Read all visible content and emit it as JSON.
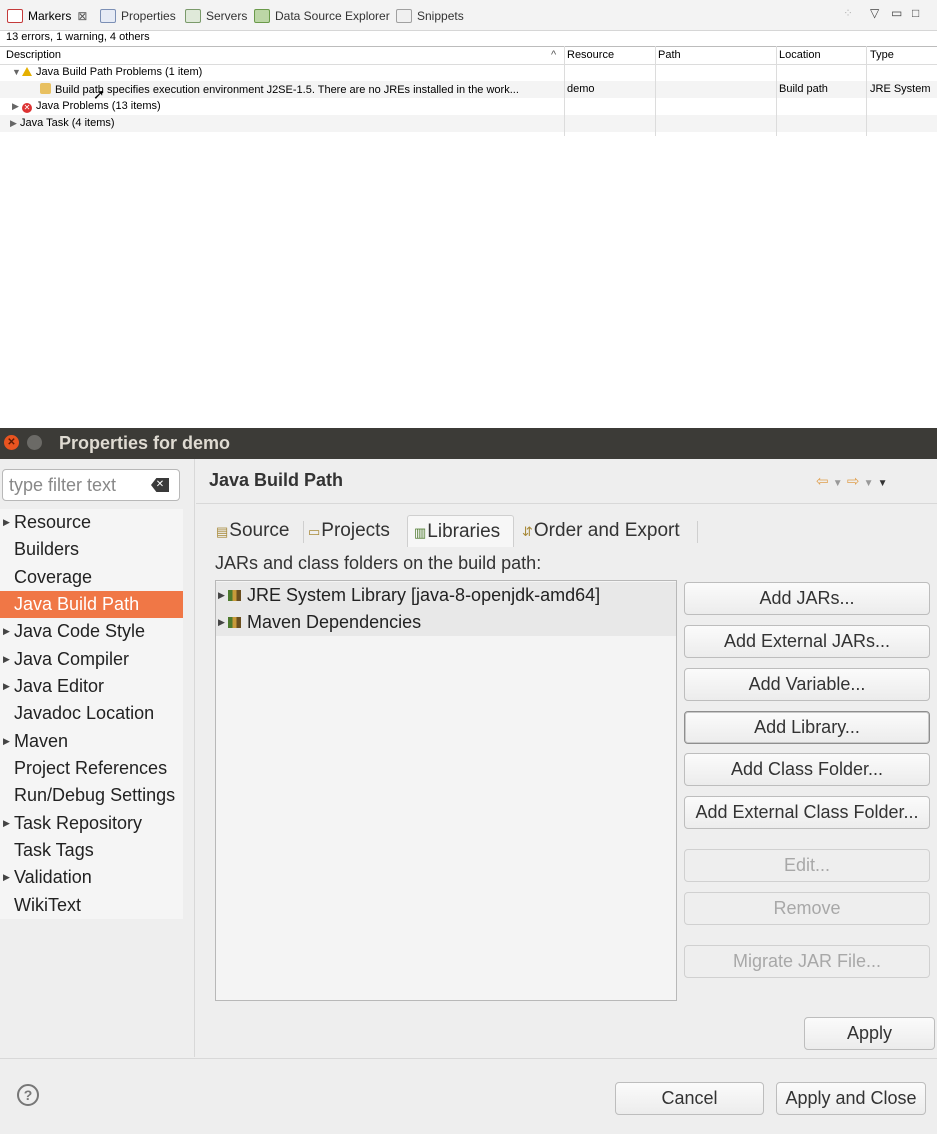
{
  "markers_view": {
    "tabs": [
      {
        "label": "Markers",
        "icon": "markers-icon",
        "color": "#c43a3a"
      },
      {
        "label": "Properties",
        "icon": "properties-icon",
        "color": "#7b8fb5"
      },
      {
        "label": "Servers",
        "icon": "servers-icon",
        "color": "#7a9a6a"
      },
      {
        "label": "Data Source Explorer",
        "icon": "data-source-icon",
        "color": "#6a9a4a"
      },
      {
        "label": "Snippets",
        "icon": "snippets-icon",
        "color": "#a0a0a0"
      }
    ],
    "summary": "13 errors, 1 warning, 4 others",
    "columns": [
      "Description",
      "Resource",
      "Path",
      "Location",
      "Type"
    ],
    "rows": [
      {
        "description": "Java Build Path Problems (1 item)",
        "resource": "",
        "path": "",
        "location": "",
        "type": "",
        "icon": "warning-icon",
        "expanded": true
      },
      {
        "description": "Build path specifies execution environment J2SE-1.5. There are no JREs installed in the work...",
        "resource": "demo",
        "path": "",
        "location": "Build path",
        "type": "JRE System",
        "icon": "warning-marker-icon"
      },
      {
        "description": "Java Problems (13 items)",
        "resource": "",
        "path": "",
        "location": "",
        "type": "",
        "icon": "error-icon",
        "expanded": false
      },
      {
        "description": "Java Task (4 items)",
        "resource": "",
        "path": "",
        "location": "",
        "type": "",
        "icon": "",
        "expanded": false
      }
    ]
  },
  "dialog": {
    "title": "Properties for demo",
    "filter_placeholder": "type filter text",
    "nav": [
      {
        "label": "Resource",
        "arrow": true
      },
      {
        "label": "Builders",
        "arrow": false
      },
      {
        "label": "Coverage",
        "arrow": false
      },
      {
        "label": "Java Build Path",
        "arrow": false,
        "selected": true
      },
      {
        "label": "Java Code Style",
        "arrow": true
      },
      {
        "label": "Java Compiler",
        "arrow": true
      },
      {
        "label": "Java Editor",
        "arrow": true
      },
      {
        "label": "Javadoc Location",
        "arrow": false
      },
      {
        "label": "Maven",
        "arrow": true
      },
      {
        "label": "Project References",
        "arrow": false
      },
      {
        "label": "Run/Debug Settings",
        "arrow": false
      },
      {
        "label": "Task Repository",
        "arrow": true
      },
      {
        "label": "Task Tags",
        "arrow": false
      },
      {
        "label": "Validation",
        "arrow": true
      },
      {
        "label": "WikiText",
        "arrow": false
      }
    ],
    "page_title": "Java Build Path",
    "tabs": [
      "Source",
      "Projects",
      "Libraries",
      "Order and Export"
    ],
    "active_tab": "Libraries",
    "description": "JARs and class folders on the build path:",
    "libraries": [
      "JRE System Library [java-8-openjdk-amd64]",
      "Maven Dependencies"
    ],
    "buttons": {
      "add_jars": "Add JARs...",
      "add_external_jars": "Add External JARs...",
      "add_variable": "Add Variable...",
      "add_library": "Add Library...",
      "add_class_folder": "Add Class Folder...",
      "add_external_class_folder": "Add External Class Folder...",
      "edit": "Edit...",
      "remove": "Remove",
      "migrate_jar": "Migrate JAR File...",
      "apply": "Apply",
      "cancel": "Cancel",
      "apply_and_close": "Apply and Close"
    },
    "colors": {
      "selection": "#f07746",
      "titlebar": "#3c3b37",
      "close": "#e95420"
    }
  }
}
